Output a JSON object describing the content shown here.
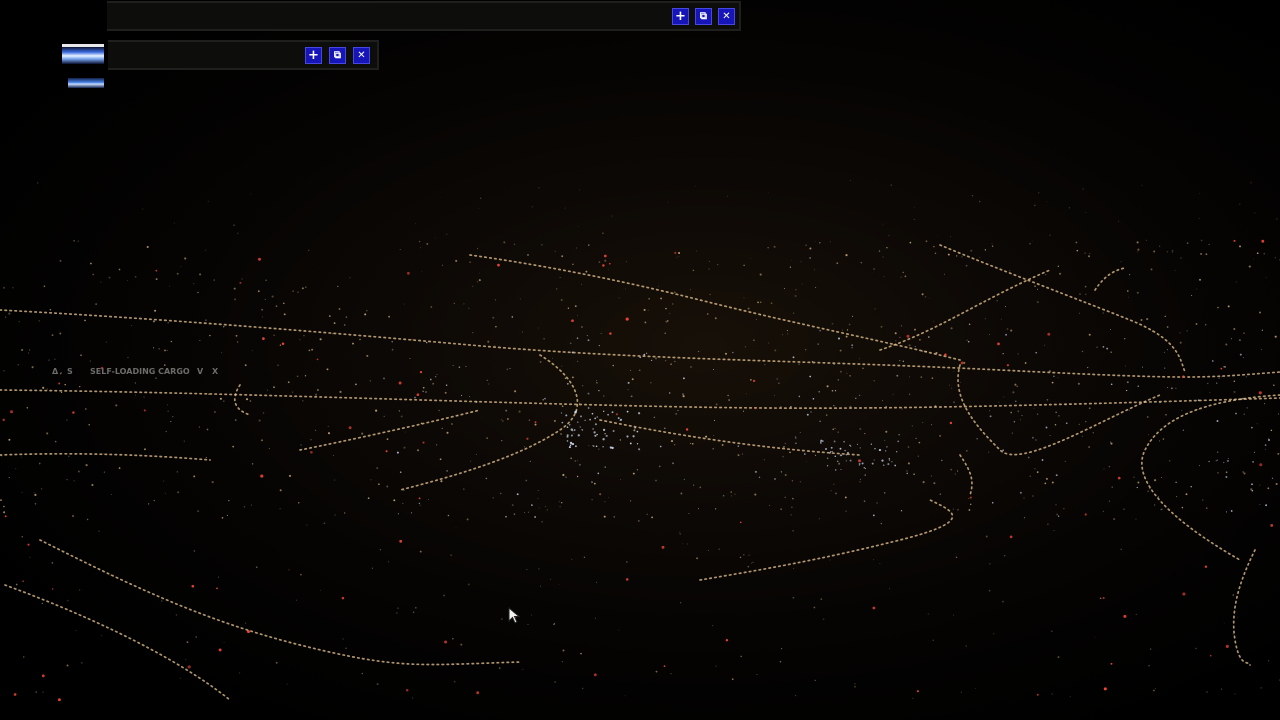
{
  "scene": {
    "description_icon": "night-city-lights-aerial"
  },
  "toolbar_top": {
    "buttons": [
      {
        "icon": "plus-icon",
        "glyph": "+"
      },
      {
        "icon": "undock-icon",
        "glyph": "⧉"
      },
      {
        "icon": "close-icon",
        "glyph": "✕"
      }
    ]
  },
  "toolbar_second": {
    "buttons": [
      {
        "icon": "plus-icon",
        "glyph": "+"
      },
      {
        "icon": "undock-icon",
        "glyph": "⧉"
      },
      {
        "icon": "close-icon",
        "glyph": "✕"
      }
    ]
  },
  "cargo_panel": {
    "up_glyph": "Δ",
    "s_label": "S",
    "title": "SELF-LOADING CARGO",
    "v_label": "V",
    "x_label": "X"
  },
  "colors": {
    "button_blue": "#1515b8",
    "city_light_amber": "#e8c590",
    "city_light_red": "#ff4a3a",
    "city_light_white": "#cfd9f2"
  }
}
